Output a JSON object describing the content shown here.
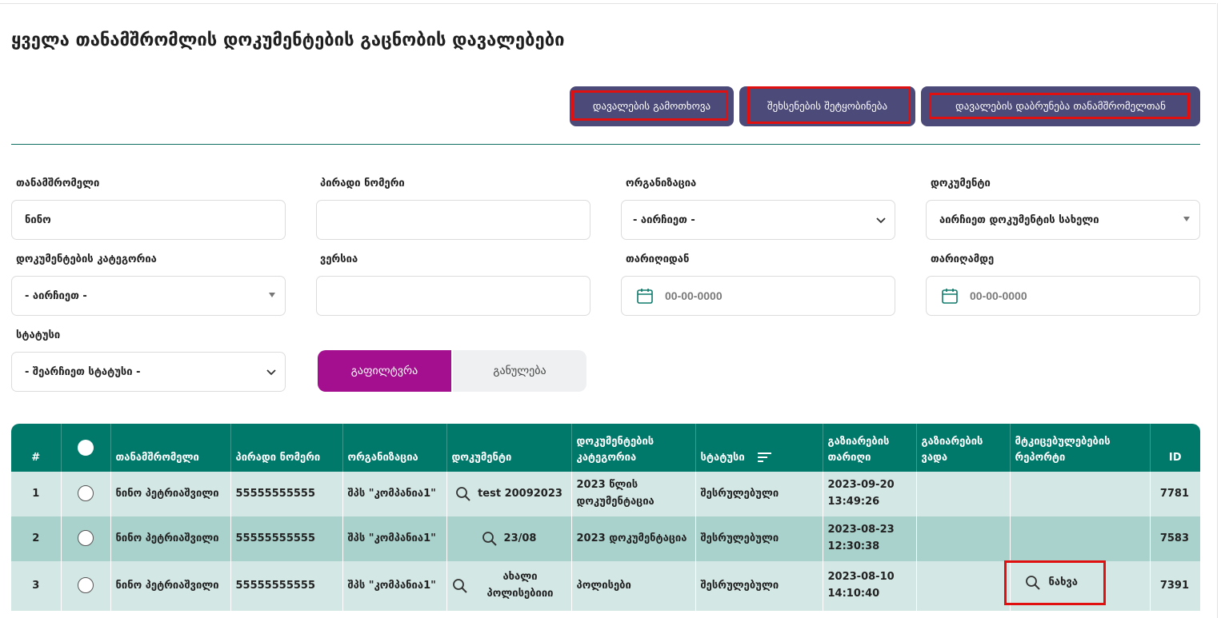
{
  "page": {
    "title": "ყველა თანამშრომლის დოკუმენტების გაცნობის დავალებები"
  },
  "actions": {
    "revoke": "დავალების გამოთხოვა",
    "remind": "შეხსენების შეტყობინება",
    "return": "დავალების დაბრუნება თანამშრომელთან"
  },
  "filters": {
    "employee": {
      "label": "თანამშრომელი",
      "value": "ნინო"
    },
    "personal_number": {
      "label": "პირადი ნომერი",
      "value": ""
    },
    "organization": {
      "label": "ორგანიზაცია",
      "value": "- აირჩიეთ -"
    },
    "document": {
      "label": "დოკუმენტი",
      "value": "აირჩიეთ დოკუმენტის სახელი"
    },
    "category": {
      "label": "დოკუმენტების კატეგორია",
      "value": "- აირჩიეთ -"
    },
    "version": {
      "label": "ვერსია",
      "value": ""
    },
    "date_from": {
      "label": "თარიღიდან",
      "placeholder": "00-00-0000"
    },
    "date_to": {
      "label": "თარიღამდე",
      "placeholder": "00-00-0000"
    },
    "status": {
      "label": "სტატუსი",
      "value": "- შეარჩიეთ სტატუსი -"
    },
    "filter_button": "გაფილტვრა",
    "reset_button": "განულება"
  },
  "table": {
    "columns": {
      "num": "#",
      "employee": "თანამშრომელი",
      "personal_number": "პირადი ნომერი",
      "organization": "ორგანიზაცია",
      "document": "დოკუმენტი",
      "category": "დოკუმენტების კატეგორია",
      "status": "სტატუსი",
      "share_date": "გაზიარების თარიღი",
      "share_deadline": "გაზიარების ვადა",
      "proof_report": "მტკიცებულებების რეპორტი",
      "id": "ID"
    },
    "rows": [
      {
        "num": "1",
        "employee": "ნინო პეტრიაშვილი",
        "personal_number": "55555555555",
        "organization": "შპს \"კომპანია1\"",
        "document": "test 20092023",
        "category": "2023 წლის დოკუმენტაცია",
        "status": "შესრულებული",
        "share_date": "2023-09-20 13:49:26",
        "share_deadline": "",
        "proof_report": "",
        "id": "7781"
      },
      {
        "num": "2",
        "employee": "ნინო პეტრიაშვილი",
        "personal_number": "55555555555",
        "organization": "შპს \"კომპანია1\"",
        "document": "23/08",
        "category": "2023 დოკუმენტაცია",
        "status": "შესრულებული",
        "share_date": "2023-08-23 12:30:38",
        "share_deadline": "",
        "proof_report": "",
        "id": "7583"
      },
      {
        "num": "3",
        "employee": "ნინო პეტრიაშვილი",
        "personal_number": "55555555555",
        "organization": "შპს \"კომპანია1\"",
        "document": "ახალი პოლისებიიი",
        "category": "პოლისები",
        "status": "შესრულებული",
        "share_date": "2023-08-10 14:10:40",
        "share_deadline": "",
        "proof_report": "ნახვა",
        "id": "7391"
      }
    ]
  },
  "colors": {
    "primary_button": "#4c4a78",
    "filter_button": "#a30f8e",
    "table_header": "#00796b",
    "status_done": "#1c8f1c",
    "highlight": "#e01010"
  }
}
